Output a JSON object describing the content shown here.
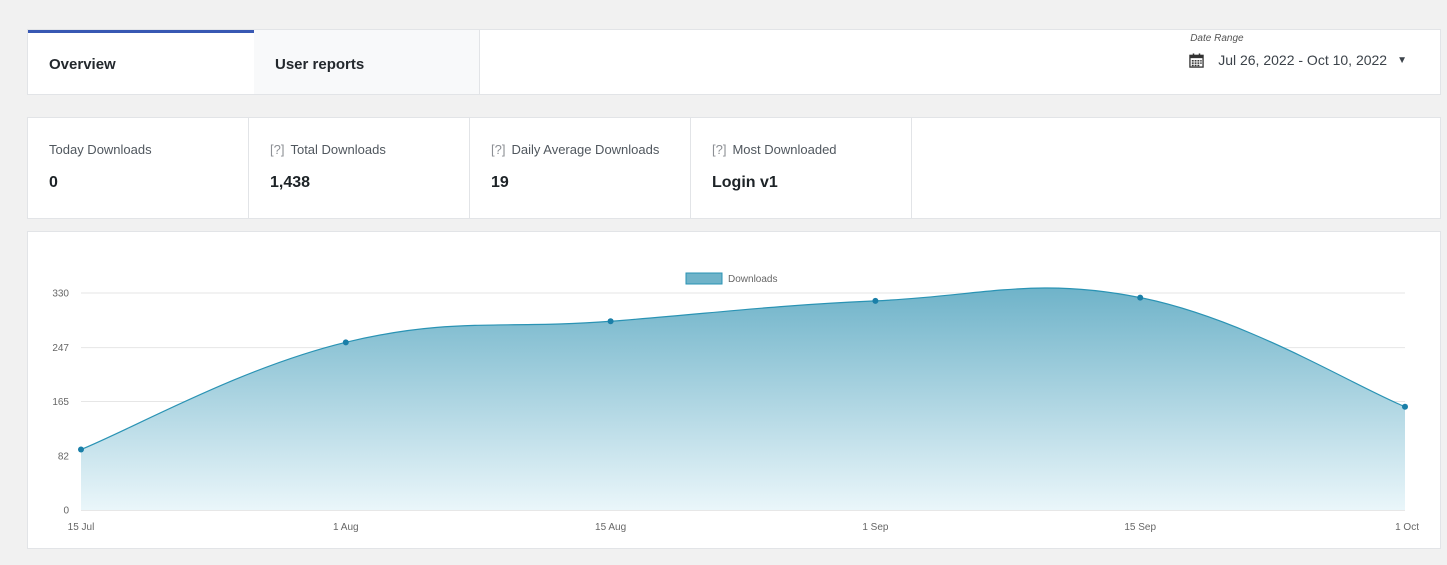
{
  "tabs": [
    {
      "label": "Overview",
      "active": true
    },
    {
      "label": "User reports",
      "active": false
    }
  ],
  "date_range": {
    "label": "Date Range",
    "value": "Jul 26, 2022 - Oct 10, 2022",
    "icon": "calendar-icon",
    "caret": "▼"
  },
  "stats": [
    {
      "title": "Today Downloads",
      "help": "",
      "value": "0"
    },
    {
      "title": "Total Downloads",
      "help": "[?]",
      "value": "1,438"
    },
    {
      "title": "Daily Average Downloads",
      "help": "[?]",
      "value": "19"
    },
    {
      "title": "Most Downloaded",
      "help": "[?]",
      "value": "Login v1"
    }
  ],
  "colors": {
    "accent": "#3858b3",
    "series_line": "#2a93b4",
    "series_point": "#1a7fa8",
    "fill_top": "#6fb3c9",
    "fill_bottom": "#eaf6fa"
  },
  "chart_data": {
    "type": "area",
    "x": [
      "15 Jul",
      "1 Aug",
      "15 Aug",
      "1 Sep",
      "15 Sep",
      "1 Oct"
    ],
    "series": [
      {
        "name": "Downloads",
        "values": [
          92,
          255,
          287,
          318,
          323,
          157
        ]
      }
    ],
    "yticks": [
      0,
      82,
      165,
      247,
      330
    ],
    "ylim": [
      0,
      330
    ],
    "grid": true,
    "legend": "top-center",
    "title": "",
    "xlabel": "",
    "ylabel": ""
  }
}
